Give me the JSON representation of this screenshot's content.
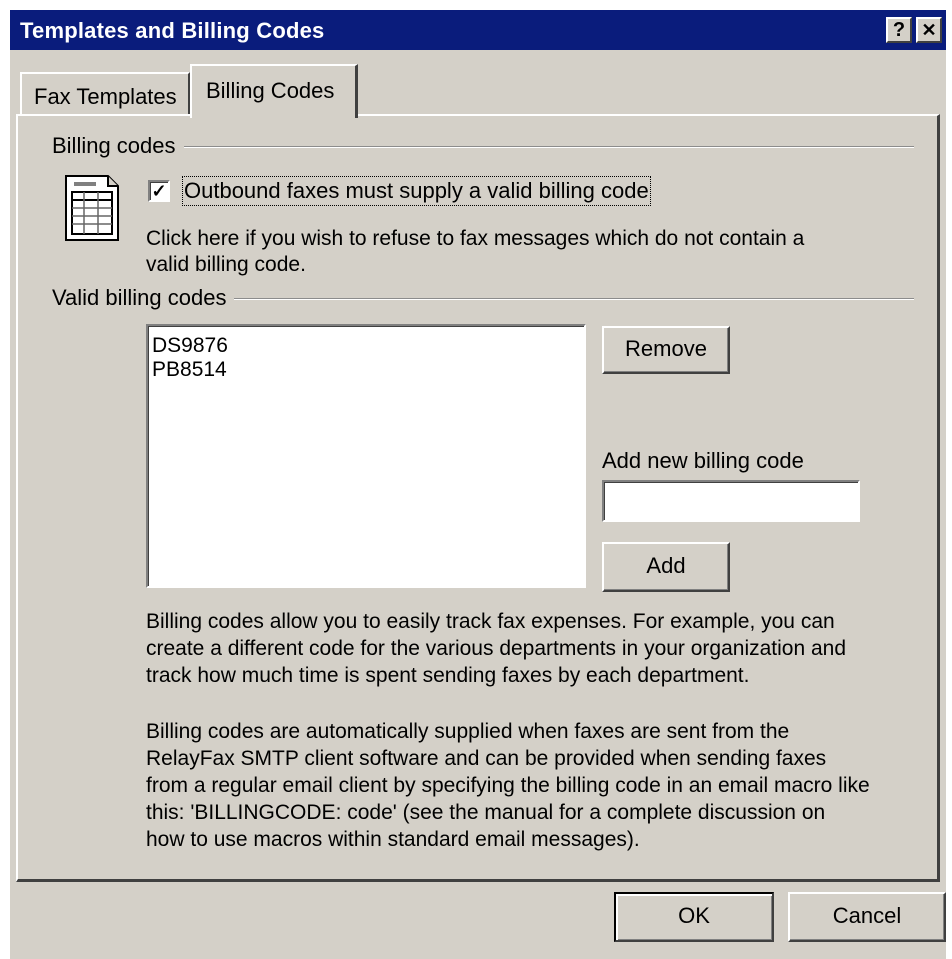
{
  "window": {
    "title": "Templates and Billing Codes",
    "help_glyph": "?",
    "close_glyph": "✕"
  },
  "tabs": [
    {
      "label": "Fax Templates",
      "active": false
    },
    {
      "label": "Billing Codes",
      "active": true
    }
  ],
  "billing": {
    "section_label": "Billing codes",
    "checkbox_checked": true,
    "checkbox_mark": "✓",
    "checkbox_label": "Outbound faxes must supply a valid billing code",
    "checkbox_help_line1": "Click here if you wish to refuse to fax messages which do not contain a",
    "checkbox_help_line2": "valid billing code."
  },
  "valid_codes": {
    "section_label": "Valid billing codes",
    "items": [
      "DS9876",
      "PB8514"
    ],
    "remove_label": "Remove",
    "add_field_label": "Add new billing code",
    "add_field_value": "",
    "add_label": "Add"
  },
  "description": {
    "para1_lines": [
      "Billing codes allow you to easily track fax expenses.  For example, you can",
      "create a different code for the various departments in your organization and",
      "track how much time is spent sending faxes by each department."
    ],
    "para2_lines": [
      "Billing codes are automatically supplied when faxes are sent from the",
      "RelayFax SMTP client software and can be provided when sending faxes",
      "from a regular email client by specifying the billing code in an email macro like",
      "this: 'BILLINGCODE: code' (see the manual for a complete discussion on",
      "how to use macros within standard email messages)."
    ]
  },
  "footer": {
    "ok_label": "OK",
    "cancel_label": "Cancel"
  },
  "colors": {
    "titlebar": "#0a1c7c",
    "face": "#d4d0c8"
  },
  "icons": {
    "billing_icon": "spreadsheet-icon"
  }
}
